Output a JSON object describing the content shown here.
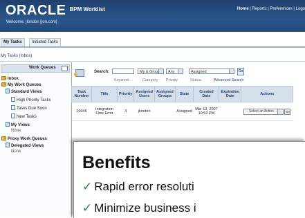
{
  "header": {
    "brand": "ORACLE",
    "product": "BPM Worklist",
    "welcome": "Welcome, jlondon [jon.com]",
    "nav": [
      "Home",
      "Reports",
      "Preferences",
      "Logo"
    ]
  },
  "tabs": [
    "My Tasks",
    "Initiated Tasks"
  ],
  "breadcrumb": "My Tasks (Inbox)",
  "left": {
    "title": "Work Queues",
    "items": {
      "inbox": "Inbox",
      "my_work_queues": "My Work Queues",
      "standard_views": "Standard Views",
      "high_priority": "High Priority Tasks",
      "due_soon": "Tasks Due Soon",
      "new_tasks": "New Tasks",
      "my_views": "My Views",
      "none1": "None",
      "proxy": "Proxy Work Queues",
      "delegated": "Delegated Views",
      "none2": "None"
    }
  },
  "search": {
    "label": "Search:",
    "keyword": "",
    "category": "My & Group",
    "priority": "Any",
    "status": "Assigned",
    "go": "Go",
    "sublabels": [
      "Keyword",
      "Category",
      "Priority",
      "Status",
      "Advanced Search"
    ]
  },
  "table": {
    "headers": [
      "Task Number",
      "Title",
      "Priority",
      "Assigned Users",
      "Assigned Groups",
      "State",
      "Created Date",
      "Expiration Date",
      "Actions"
    ],
    "row": {
      "number": "10046",
      "title": "Integration Flow Error",
      "priority": "3",
      "users": "jlondon",
      "groups": "",
      "state": "Assigned",
      "created": "Mar 13, 2007 10:52 PM",
      "expiration": "",
      "action": "-- Select an Action --",
      "go": "Go"
    }
  },
  "overlay": {
    "title": "Benefits",
    "check": "✓",
    "bullets": [
      "Rapid error resoluti",
      "Minimize business i"
    ]
  }
}
